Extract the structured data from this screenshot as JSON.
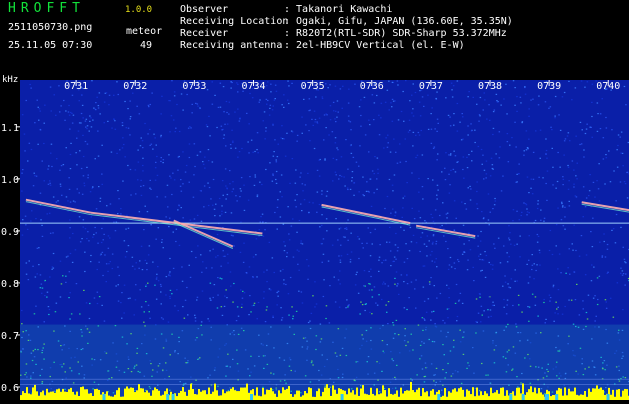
{
  "header": {
    "app_name": "HROFFT",
    "app_version": "1.0.0",
    "file_name": "2511050730.png",
    "meteor_label": "meteor",
    "date_time": "25.11.05 07:30",
    "meteor_count": "49",
    "info": [
      {
        "label": "Observer",
        "value": ": Takanori Kawachi"
      },
      {
        "label": "Receiving Location",
        "value": ": Ogaki, Gifu, JAPAN (136.60E, 35.35N)"
      },
      {
        "label": "Receiver",
        "value": ": R820T2(RTL-SDR) SDR-Sharp 53.372MHz"
      },
      {
        "label": "Receiving antenna",
        "value": ": 2el-HB9CV Vertical (el. E-W)"
      }
    ]
  },
  "spectrogram": {
    "y_unit": "kHz",
    "time_ticks": [
      "0731",
      "0732",
      "0733",
      "0734",
      "0735",
      "0736",
      "0737",
      "0738",
      "0739",
      "0740"
    ],
    "freq_ticks": [
      "1.1",
      "1.0",
      "0.9",
      "0.8",
      "0.7",
      "0.6"
    ],
    "freq_range_khz": [
      0.575,
      1.19
    ],
    "time_range_min": [
      0,
      10.3
    ],
    "colors": {
      "background": "#0a1fa8",
      "tick_line": "#ffffff",
      "carrier_line": "#9fd0ff",
      "noise_band": "#2fc8c8",
      "amplitude_bars": "#ffff00"
    },
    "carrier_khz": 0.915,
    "meteor_traces": [
      {
        "t0": 0.1,
        "f0": 0.96,
        "t1": 1.2,
        "f1": 0.935
      },
      {
        "t0": 1.2,
        "f0": 0.935,
        "t1": 4.1,
        "f1": 0.895
      },
      {
        "t0": 2.6,
        "f0": 0.92,
        "t1": 3.6,
        "f1": 0.87
      },
      {
        "t0": 5.1,
        "f0": 0.95,
        "t1": 6.6,
        "f1": 0.915
      },
      {
        "t0": 6.7,
        "f0": 0.91,
        "t1": 7.7,
        "f1": 0.89
      },
      {
        "t0": 9.5,
        "f0": 0.955,
        "t1": 10.3,
        "f1": 0.94
      }
    ]
  }
}
